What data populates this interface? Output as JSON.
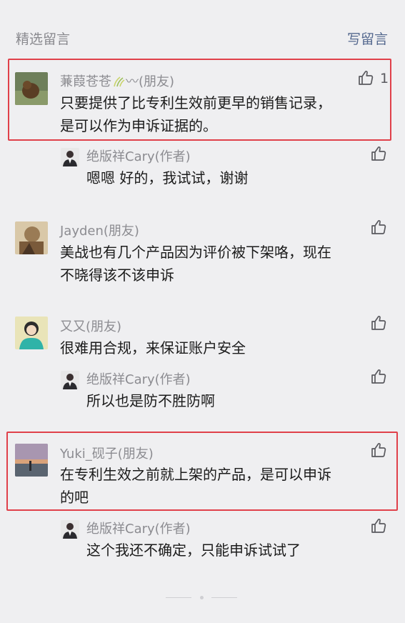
{
  "header": {
    "section_title": "精选留言",
    "write_label": "写留言"
  },
  "comments": [
    {
      "name": "蒹葭苍苍",
      "name_suffix": "〰(朋友)",
      "text_lines": [
        "只要提供了比专利生效前更早的销售记录，",
        "是可以作为申诉证据的。"
      ],
      "likes": "1",
      "reply": {
        "name": "绝版祥Cary(作者)",
        "text": "嗯嗯  好的，我试试，谢谢"
      }
    },
    {
      "name": "Jayden(朋友)",
      "text_lines": [
        "美战也有几个产品因为评价被下架咯，现在",
        "不晓得该不该申诉"
      ]
    },
    {
      "name": "又又(朋友)",
      "text_lines": [
        "很难用合规，来保证账户安全"
      ],
      "reply": {
        "name": "绝版祥Cary(作者)",
        "text": "所以也是防不胜防啊"
      }
    },
    {
      "name": "Yuki_砚子(朋友)",
      "text_lines": [
        "在专利生效之前就上架的产品，是可以申诉",
        "的吧"
      ],
      "reply": {
        "name": "绝版祥Cary(作者)",
        "text": "这个我还不确定，只能申诉试试了"
      }
    }
  ],
  "colors": {
    "highlight": "#e0404a",
    "link": "#55698f",
    "name": "#8c8c91",
    "background": "#efeff1"
  },
  "icons": {
    "like": "thumbs-up-icon",
    "leaf": "wheat-leaf-icon"
  }
}
